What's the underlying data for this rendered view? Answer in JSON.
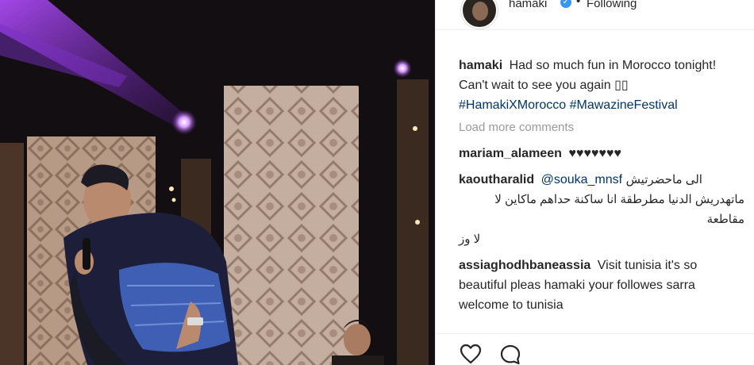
{
  "header": {
    "username": "hamaki",
    "follow_status": "Following",
    "separator": "•"
  },
  "caption": {
    "username": "hamaki",
    "text": "Had so much fun in Morocco tonight! Can't wait to see you again",
    "emoji": "▯▯",
    "hashtags": [
      "#HamakiXMorocco",
      "#MawazineFestival"
    ]
  },
  "load_more_label": "Load more comments",
  "comments": [
    {
      "username": "mariam_alameen",
      "hearts": "♥♥♥♥♥♥♥"
    },
    {
      "username": "kaoutharalid",
      "mention": "@souka_mnsf",
      "line1": "الى ماحضرتيش",
      "line2": "ماتهدريش الدنيا مطرطقة انا ساكنة حداهم ماكاين لا مقاطعة",
      "line3": "لا وز"
    },
    {
      "username": "assiaghodhbaneassia",
      "text": "Visit tunisia it's so beautiful pleas hamaki your followes sarra welcome to tunisia"
    }
  ],
  "icons": {
    "like": "heart-icon",
    "comment": "comment-icon"
  },
  "colors": {
    "link": "#003569",
    "muted": "#999999",
    "text": "#262626",
    "verified": "#3897f0"
  }
}
